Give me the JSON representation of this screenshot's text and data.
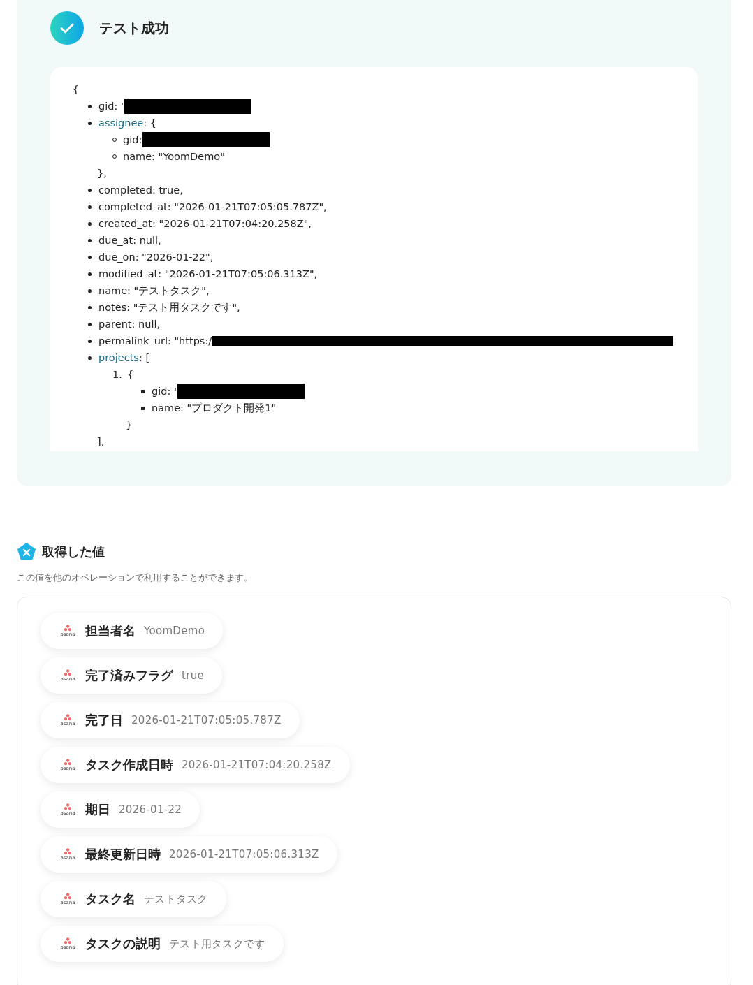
{
  "test_result": {
    "title": "テスト成功",
    "success": true,
    "response": {
      "open": "{",
      "items": [
        {
          "text": "gid: '",
          "redacted": true
        },
        {
          "key": "assignee",
          "text": ": {",
          "linked": true,
          "close": "},",
          "children": [
            {
              "kind": "circle",
              "text": "gid: ",
              "redacted": true
            },
            {
              "kind": "circle",
              "text": "name: \"YoomDemo\""
            }
          ]
        },
        {
          "text": "completed: true,"
        },
        {
          "text": "completed_at: \"2026-01-21T07:05:05.787Z\","
        },
        {
          "text": "created_at: \"2026-01-21T07:04:20.258Z\","
        },
        {
          "text": "due_at: null,"
        },
        {
          "text": "due_on: \"2026-01-22\","
        },
        {
          "text": "modified_at: \"2026-01-21T07:05:06.313Z\","
        },
        {
          "text": "name: \"テストタスク\","
        },
        {
          "text": "notes: \"テスト用タスクです\","
        },
        {
          "text": "parent: null,"
        },
        {
          "text": "permalink_url: \"https:/",
          "redacted": true,
          "wide": true
        },
        {
          "key": "projects",
          "text": ": [",
          "linked": true,
          "close": "],",
          "children": [
            {
              "kind": "ordered",
              "marker": "1.",
              "text": "{",
              "close": "}",
              "children": [
                {
                  "kind": "square",
                  "text": "gid: '",
                  "redacted": true
                },
                {
                  "kind": "square",
                  "text": "name: \"プロダクト開発1\""
                }
              ]
            }
          ]
        }
      ]
    }
  },
  "values_section": {
    "title": "取得した値",
    "description": "この値を他のオペレーションで利用することができます。",
    "values": [
      {
        "app": "asana",
        "label": "担当者名",
        "value": "YoomDemo"
      },
      {
        "app": "asana",
        "label": "完了済みフラグ",
        "value": "true"
      },
      {
        "app": "asana",
        "label": "完了日",
        "value": "2026-01-21T07:05:05.787Z"
      },
      {
        "app": "asana",
        "label": "タスク作成日時",
        "value": "2026-01-21T07:04:20.258Z"
      },
      {
        "app": "asana",
        "label": "期日",
        "value": "2026-01-22"
      },
      {
        "app": "asana",
        "label": "最終更新日時",
        "value": "2026-01-21T07:05:06.313Z"
      },
      {
        "app": "asana",
        "label": "タスク名",
        "value": "テストタスク"
      },
      {
        "app": "asana",
        "label": "タスクの説明",
        "value": "テスト用タスクです"
      }
    ]
  }
}
